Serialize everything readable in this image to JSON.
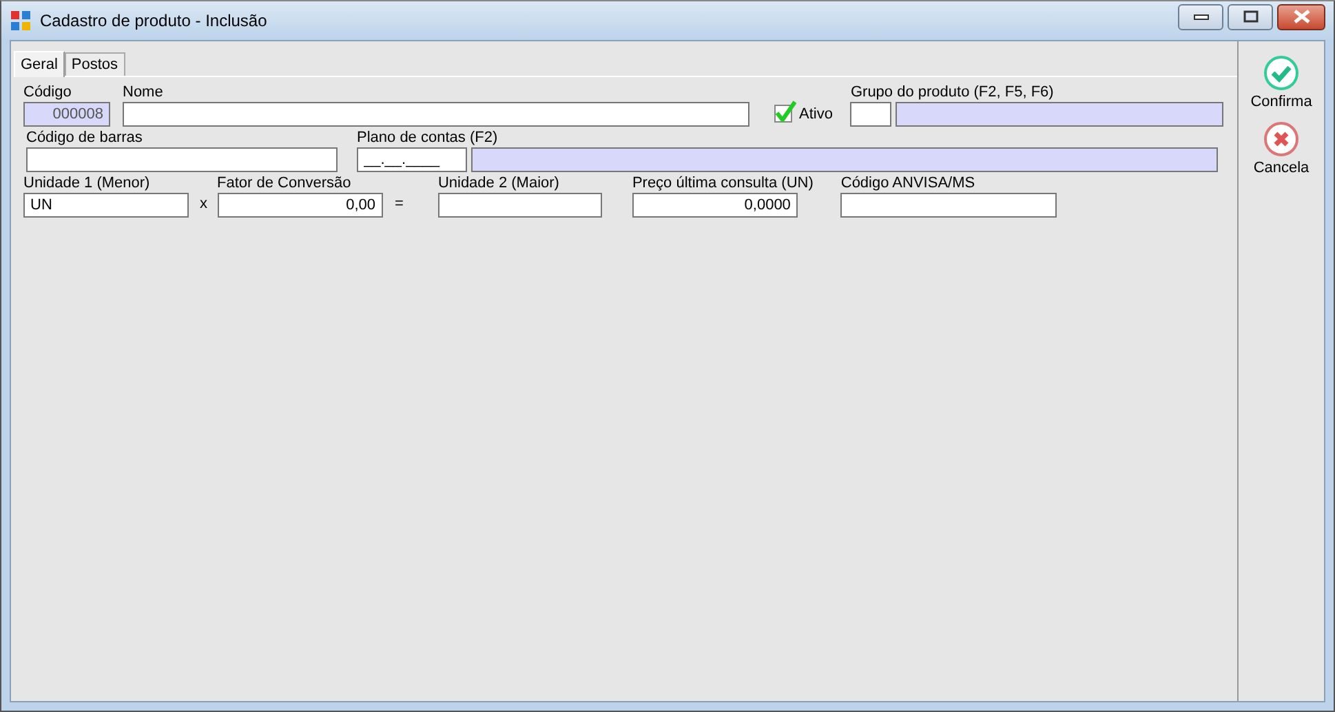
{
  "window": {
    "title": "Cadastro de produto - Inclusão"
  },
  "tabs": [
    {
      "label": "Geral",
      "selected": true
    },
    {
      "label": "Postos",
      "selected": false
    }
  ],
  "rows": [
    [
      {
        "kind": "field",
        "label": "Código",
        "inputs": [
          {
            "kind": "number",
            "value": "000008",
            "readonly": true
          }
        ]
      },
      {
        "kind": "field",
        "label": "Nome",
        "inputs": [
          {
            "kind": "text",
            "readonly": false
          }
        ]
      },
      {
        "kind": "checkbox",
        "label": "Ativo",
        "checked": true
      },
      {
        "kind": "field",
        "label": "Grupo do produto (F2, F5, F6)",
        "inputs": [
          {
            "kind": "text",
            "readonly": false
          },
          {
            "kind": "text",
            "readonly": true
          }
        ]
      }
    ],
    [
      {
        "kind": "field",
        "label": "Código de barras",
        "inputs": [
          {
            "kind": "text",
            "readonly": false
          }
        ]
      },
      {
        "kind": "field",
        "label": "Plano de contas (F2)",
        "inputs": [
          {
            "kind": "text",
            "value": "__.__.____",
            "readonly": false
          },
          {
            "kind": "text",
            "readonly": true
          }
        ]
      }
    ],
    [
      {
        "kind": "field",
        "label": "Unidade 1 (Menor)",
        "inputs": [
          {
            "kind": "text",
            "value": "UN",
            "readonly": false
          }
        ]
      },
      {
        "kind": "operator",
        "text": "x"
      },
      {
        "kind": "field",
        "label": "Fator de Conversão",
        "inputs": [
          {
            "kind": "number",
            "value": "0,00",
            "readonly": false
          }
        ]
      },
      {
        "kind": "operator",
        "text": "="
      },
      {
        "kind": "field",
        "label": "Unidade 2 (Maior)",
        "inputs": [
          {
            "kind": "text",
            "readonly": false
          }
        ]
      },
      {
        "kind": "field",
        "label": "Preço última consulta (UN)",
        "inputs": [
          {
            "kind": "number",
            "value": "0,0000",
            "readonly": false
          }
        ]
      },
      {
        "kind": "field",
        "label": "Código ANVISA/MS",
        "inputs": [
          {
            "kind": "text",
            "readonly": false
          }
        ]
      }
    ]
  ],
  "actions": [
    {
      "kind": "confirm",
      "label": "Confirma"
    },
    {
      "kind": "cancel",
      "label": "Cancela"
    }
  ]
}
